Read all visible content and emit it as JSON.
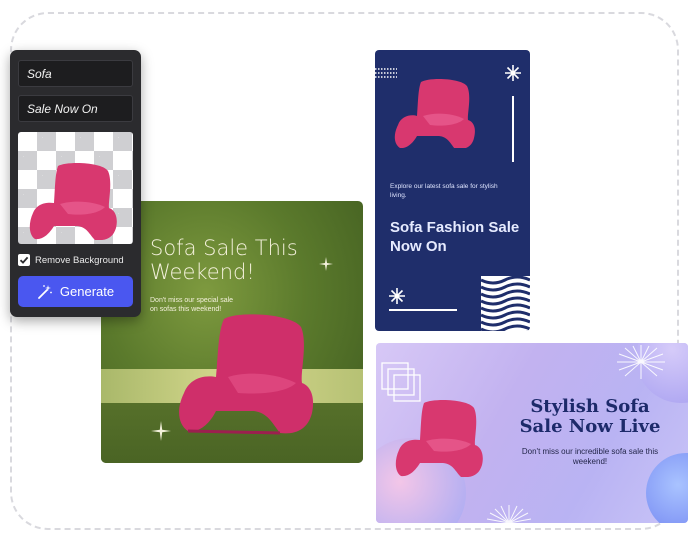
{
  "editor": {
    "field_1_value": "Sofa",
    "field_2_value": "Sale Now On",
    "remove_background_label": "Remove Background",
    "remove_background_checked": true,
    "generate_label": "Generate"
  },
  "cards": {
    "green": {
      "title": "Sofa Sale This Weekend!",
      "description": "Don't miss our special sale on sofas this weekend!"
    },
    "navy": {
      "description": "Explore our latest sofa sale for stylish living.",
      "title": "Sofa Fashion Sale Now On"
    },
    "purple": {
      "title": "Stylish Sofa Sale Now Live",
      "description": "Don't miss our incredible sofa sale this weekend!"
    }
  },
  "icons": {
    "generate": "magic-wand-icon",
    "sparkle": "sparkle-icon",
    "checkmark": "checkmark-icon"
  },
  "colors": {
    "generate_button": "#4a57f0",
    "navy_card": "#1f2e6b",
    "sofa_pink": "#d8386f"
  }
}
